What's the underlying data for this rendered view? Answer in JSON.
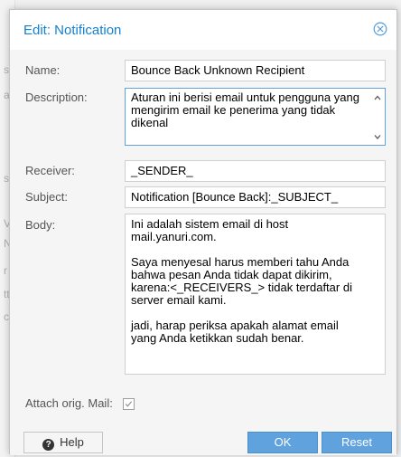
{
  "window": {
    "title": "Edit: Notification"
  },
  "form": {
    "name_label": "Name:",
    "name_value": "Bounce Back Unknown Recipient",
    "description_label": "Description:",
    "description_value": "Aturan ini berisi email untuk pengguna yang mengirim email ke penerima yang tidak dikenal",
    "receiver_label": "Receiver:",
    "receiver_value": "_SENDER_",
    "subject_label": "Subject:",
    "subject_value": "Notification [Bounce Back]:_SUBJECT_",
    "body_label": "Body:",
    "body_lines": [
      "Ini adalah sistem email di host",
      "mail.yanuri.com.",
      "",
      "Saya menyesal harus memberi tahu Anda",
      "bahwa pesan Anda tidak dapat dikirim,",
      "karena:<_RECEIVERS_> tidak terdaftar di",
      "server email kami.",
      "",
      "jadi, harap periksa apakah alamat email",
      "yang Anda ketikkan sudah benar."
    ],
    "attach_label": "Attach orig. Mail:",
    "attach_checked": true
  },
  "buttons": {
    "help_label": "Help",
    "ok_label": "OK",
    "reset_label": "Reset"
  },
  "background": {
    "glyphs": [
      "s",
      "a",
      "s",
      "V",
      "N",
      "r",
      "tt",
      "cl"
    ]
  },
  "colors": {
    "accent": "#157fcc",
    "button_primary": "#5fa2dd",
    "focus_border": "#5fa2dd"
  },
  "icons": {
    "close": "close-icon",
    "help": "help-icon",
    "check": "check-icon",
    "scroll_up": "chevron-up-icon",
    "scroll_down": "chevron-down-icon"
  }
}
